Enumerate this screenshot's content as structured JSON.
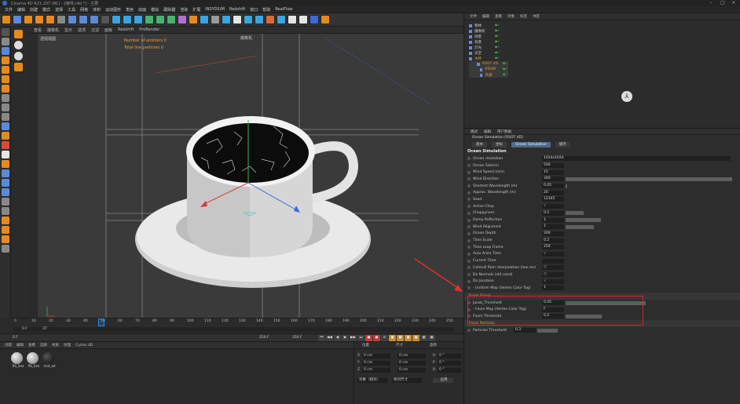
{
  "window": {
    "title": "Cinema 4D R21.207 (RC) - [咖啡.c4d *] - 主要"
  },
  "menubar": {
    "items": [
      "文件",
      "编辑",
      "创建",
      "模式",
      "选择",
      "工具",
      "网格",
      "体积",
      "运动图形",
      "角色",
      "动画",
      "模拟",
      "跟踪器",
      "渲染",
      "扩展",
      "INSYDIUM",
      "Redshift",
      "窗口",
      "帮助",
      "RealFlow"
    ]
  },
  "viewport_menu": [
    "查看",
    "摄像机",
    "显示",
    "选项",
    "过滤",
    "面板",
    "Redshift",
    "ProRender"
  ],
  "viewport": {
    "label": "透视视图",
    "camera": "摄像机",
    "hud_lines": [
      "Number of emitters 0",
      "Total live particles 0"
    ],
    "grid_spacing": "网格间距：100 cm",
    "fps": "帧速：3.7"
  },
  "outliner": {
    "menu": [
      "文件",
      "编辑",
      "查看",
      "对象",
      "标签",
      "书签"
    ],
    "items": [
      "物体",
      "摄像机",
      "场景",
      "背景",
      "灯光",
      "天空",
      "水杯",
      "RSOT 4D",
      "RSGM",
      "外部"
    ]
  },
  "attr": {
    "menu": [
      "模式",
      "编辑",
      "用户数据"
    ],
    "object_title": "Ocean Simulation [RSOT 4D]",
    "tabs": [
      "基本",
      "坐标",
      "Ocean Simulation",
      "缓存"
    ],
    "section_title": "Ocean Simulation",
    "params": [
      {
        "label": "Ocean resolution",
        "value": "1024x1024",
        "bar": 0
      },
      {
        "label": "Ocean Size(m)",
        "value": "500",
        "bar": 0
      },
      {
        "label": "Wind Speed (m/s)",
        "value": "15",
        "bar": 0
      },
      {
        "label": "Wind Direction",
        "value": "340",
        "bar": 0.94
      },
      {
        "label": "Shortest Wavelength (m)",
        "value": "0.05",
        "bar": 0.01
      },
      {
        "label": "Approx. Wavelength (m)",
        "value": "20",
        "bar": 0
      },
      {
        "label": "Seed",
        "value": "12345",
        "bar": 0
      },
      {
        "label": "Active Chop",
        "value": "✓",
        "bar": 0
      },
      {
        "label": "Choppyness",
        "value": "0.5",
        "bar": 0.1
      },
      {
        "label": "Damp Reflection",
        "value": "1",
        "bar": 0.2
      },
      {
        "label": "Wind Alignment",
        "value": "1",
        "bar": 0.16
      },
      {
        "label": "Ocean Depth",
        "value": "200",
        "bar": 0
      },
      {
        "label": "Time Scale",
        "value": "0.2",
        "bar": 0
      },
      {
        "label": "Time Loop Frame",
        "value": "250",
        "bar": 0
      },
      {
        "label": "Auto Anim Time",
        "value": "✓",
        "bar": 0
      },
      {
        "label": "Current Time",
        "value": "",
        "bar": 0
      },
      {
        "label": "Catmull Rom interpolation (low res)",
        "value": "○",
        "bar": 0
      },
      {
        "label": "Do Normals (std used)",
        "value": "○",
        "bar": 0
      },
      {
        "label": "Do Jacobian",
        "value": "✓",
        "bar": 0
      },
      {
        "label": "- Uniform Map (Vertex Color Tag)",
        "value": "1",
        "bar": 0
      }
    ],
    "foam_section": "Foam Group",
    "foam_params": [
      {
        "label": "Jacob_Threshold",
        "value": "0.45",
        "bar": 0.8
      },
      {
        "label": "- Foam Map (Vertex Color Tag)",
        "value": "F",
        "bar": 0
      },
      {
        "label": "Foam Threshold",
        "value": "0.2",
        "bar": 0.36
      }
    ],
    "particles_section": "Foam Particles",
    "particles_threshold": {
      "label": "Particles Threshold",
      "value": "0.3"
    }
  },
  "timeline": {
    "ticks": [
      "0",
      "10",
      "20",
      "30",
      "40",
      "50",
      "60",
      "70",
      "80",
      "90",
      "100",
      "110",
      "120",
      "130",
      "140",
      "150",
      "160",
      "170",
      "180",
      "190",
      "200",
      "210",
      "220",
      "230",
      "240",
      "250"
    ],
    "current_frame": "37",
    "start": "0 F",
    "current": "37",
    "end_field": "250 F",
    "end_field2": "250 F",
    "frame_label": "0 F"
  },
  "materials": {
    "menu": [
      "创建",
      "编辑",
      "查看",
      "选择",
      "材质",
      "纹理",
      "Cycles 4D"
    ],
    "items": [
      "RS_Sea",
      "RS_Sea",
      "mat_ad"
    ]
  },
  "coords": {
    "headers": [
      "位置",
      "尺寸",
      "旋转"
    ],
    "rows": [
      {
        "axis": "X",
        "pos": "0 cm",
        "size": "0 cm",
        "rot_axis": "H",
        "rot": "0 °"
      },
      {
        "axis": "Y",
        "pos": "0 cm",
        "size": "0 cm",
        "rot_axis": "P",
        "rot": "0 °"
      },
      {
        "axis": "Z",
        "pos": "0 cm",
        "size": "0 cm",
        "rot_axis": "B",
        "rot": "0 °"
      }
    ],
    "mode1": "对象（相对）",
    "mode2": "绝对尺寸",
    "apply": "应用"
  },
  "colors": {
    "accent": "#4a6a8f",
    "highlight_box": "#d8242a",
    "arrow": "#e0302e",
    "hud_text": "#e8a23a"
  }
}
